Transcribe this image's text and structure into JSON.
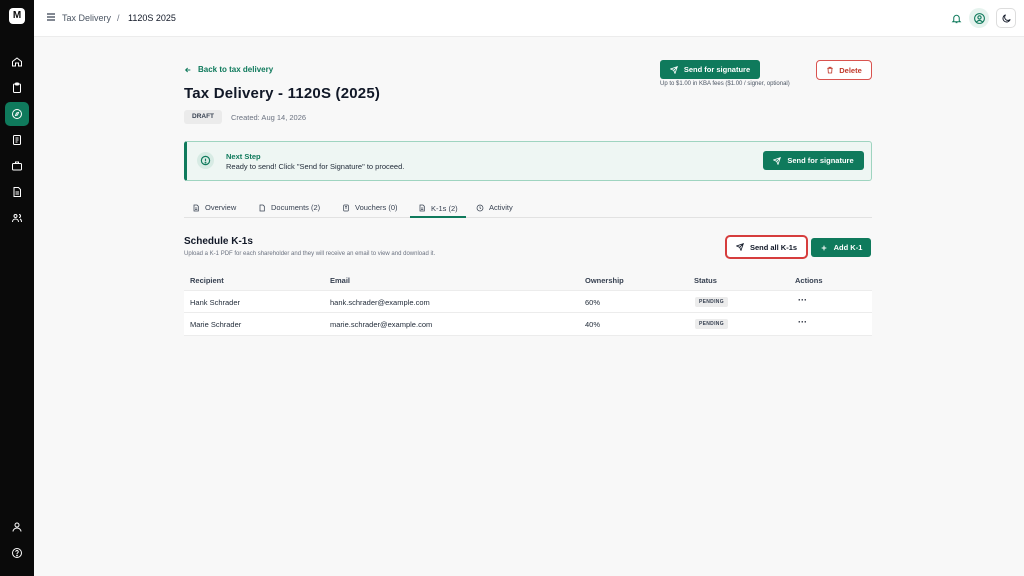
{
  "app": {
    "logo_text": "M"
  },
  "header": {
    "breadcrumb_parent": "Tax Delivery",
    "breadcrumb_separator": "/",
    "breadcrumb_current": "1120S 2025",
    "icons": [
      "menu-icon",
      "bell-icon",
      "user-avatar-icon",
      "moon-icon"
    ]
  },
  "sidebar": {
    "items": [
      {
        "name": "home-icon"
      },
      {
        "name": "clipboard-icon"
      },
      {
        "name": "compass-icon",
        "active": true
      },
      {
        "name": "receipt-icon"
      },
      {
        "name": "briefcase-icon"
      },
      {
        "name": "document-icon"
      },
      {
        "name": "users-icon"
      }
    ],
    "bottom": [
      {
        "name": "profile-icon"
      },
      {
        "name": "help-icon"
      }
    ]
  },
  "page": {
    "back_label": "Back to tax delivery",
    "title": "Tax Delivery - 1120S (2025)",
    "status_badge": "DRAFT",
    "created": "Created: Aug 14, 2026",
    "send_signature_label": "Send for signature",
    "kba_note": "Up to $1.00 in KBA fees ($1.00 / signer, optional)",
    "delete_label": "Delete"
  },
  "next_step": {
    "title": "Next Step",
    "text": "Ready to send! Click \"Send for Signature\" to proceed.",
    "button_label": "Send for signature"
  },
  "tabs": [
    {
      "label": "Overview",
      "icon": "document-icon"
    },
    {
      "label": "Documents (2)",
      "icon": "file-icon"
    },
    {
      "label": "Vouchers (0)",
      "icon": "receipt-icon"
    },
    {
      "label": "K-1s (2)",
      "icon": "file-text-icon",
      "active": true
    },
    {
      "label": "Activity",
      "icon": "clock-icon"
    }
  ],
  "k1": {
    "title": "Schedule K-1s",
    "subtitle": "Upload a K-1 PDF for each shareholder and they will receive an email to view and download it.",
    "send_all_label": "Send all K-1s",
    "add_label": "Add K-1",
    "columns": [
      "Recipient",
      "Email",
      "Ownership",
      "Status",
      "Actions"
    ],
    "rows": [
      {
        "recipient": "Hank Schrader",
        "email": "hank.schrader@example.com",
        "ownership": "60%",
        "status": "PENDING",
        "actions": "···"
      },
      {
        "recipient": "Marie Schrader",
        "email": "marie.schrader@example.com",
        "ownership": "40%",
        "status": "PENDING",
        "actions": "···"
      }
    ]
  },
  "colors": {
    "accent": "#0f7a5c",
    "danger": "#d63d3d",
    "sidebar_bg": "#0a0a0a"
  }
}
